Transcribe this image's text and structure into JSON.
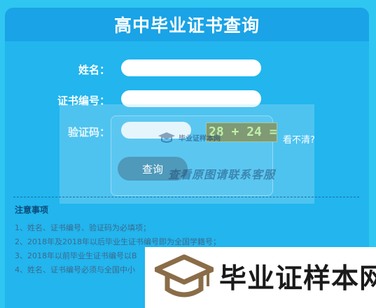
{
  "header": {
    "title": "高中毕业证书查询"
  },
  "form": {
    "name_label": "姓名：",
    "cert_label": "证书编号：",
    "code_label": "验证码：",
    "name_value": "",
    "cert_value": "",
    "code_value": "",
    "captcha_text": "28 + 24 =",
    "refresh_label": "看不清?",
    "submit_label": "查询"
  },
  "watermark": {
    "small_text": "毕业证样本网",
    "overlay_line": "查看原图请联系客服"
  },
  "notes": {
    "title": "注意事项",
    "items": [
      "1、姓名、证书编号、验证码为必填项；",
      "2、2018年及2018年以后毕业生证书编号即为全国学籍号；",
      "3、2018年以前毕业生证书编号以B",
      "4、姓名、证书编号必须与全国中小"
    ]
  },
  "banner": {
    "text": "毕业证样本网",
    "icon": "graduation-cap-icon"
  },
  "colors": {
    "background": "#2fc6f2",
    "panel": "#22b5ee",
    "header": "#1aa3e6",
    "captcha_bg": "#7f9a74"
  }
}
